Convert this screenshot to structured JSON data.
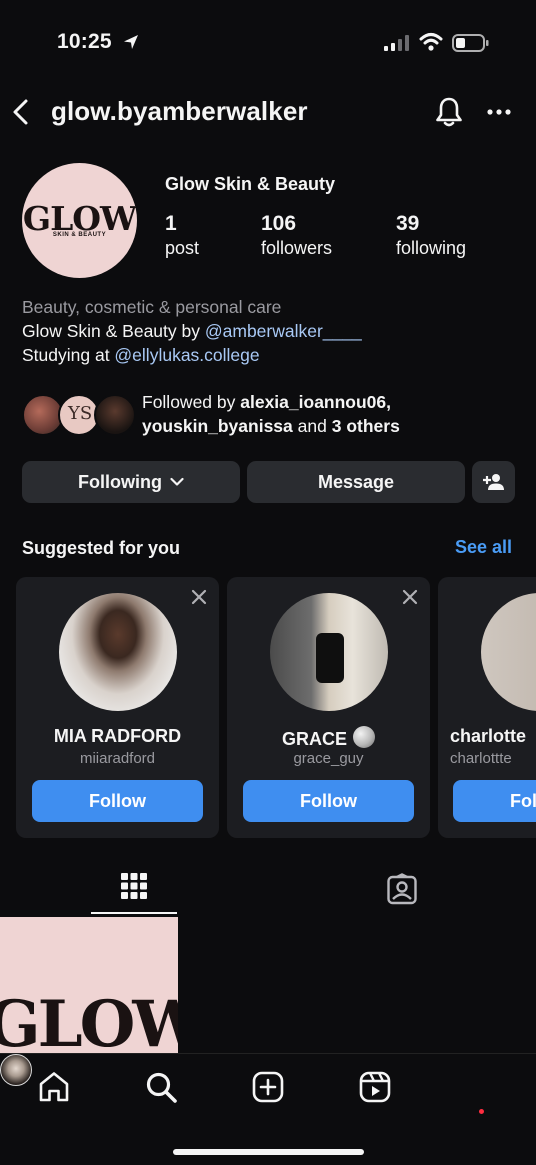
{
  "status_bar": {
    "time": "10:25"
  },
  "header": {
    "username": "glow.byamberwalker"
  },
  "profile": {
    "avatar_logo": "GLOW",
    "avatar_logo_sub": "SKIN & BEAUTY",
    "display_name": "Glow Skin & Beauty",
    "stats": {
      "posts": {
        "value": "1",
        "label": "post"
      },
      "followers": {
        "value": "106",
        "label": "followers"
      },
      "following": {
        "value": "39",
        "label": "following"
      }
    },
    "bio": {
      "category": "Beauty, cosmetic & personal care",
      "line1_prefix": "Glow Skin & Beauty by ",
      "line1_link": "@amberwalker____",
      "line2_prefix": "Studying at ",
      "line2_link": "@ellylukas.college"
    },
    "followed_by": {
      "prefix": "Followed by ",
      "user1": "alexia_ioannou06",
      "sep": ",",
      "user2": "youskin_byanissa",
      "and": " and ",
      "others": "3 others",
      "avatar2_text": "YS"
    }
  },
  "actions": {
    "following": "Following",
    "message": "Message"
  },
  "suggested": {
    "title": "Suggested for you",
    "see_all": "See all",
    "cards": [
      {
        "name": "MIA RADFORD",
        "handle": "miiaradford",
        "button": "Follow"
      },
      {
        "name": "GRACE",
        "handle": "grace_guy",
        "button": "Follow"
      },
      {
        "name": "charlotte",
        "handle": "charlottte",
        "button": "Follow"
      }
    ]
  },
  "grid_post": {
    "logo": "GLOW"
  },
  "colors": {
    "accent": "#3f8ef0",
    "link": "#a9c9f5",
    "background": "#0c0c0e",
    "card": "#1c1d21",
    "brand_pink": "#efd4d3"
  }
}
